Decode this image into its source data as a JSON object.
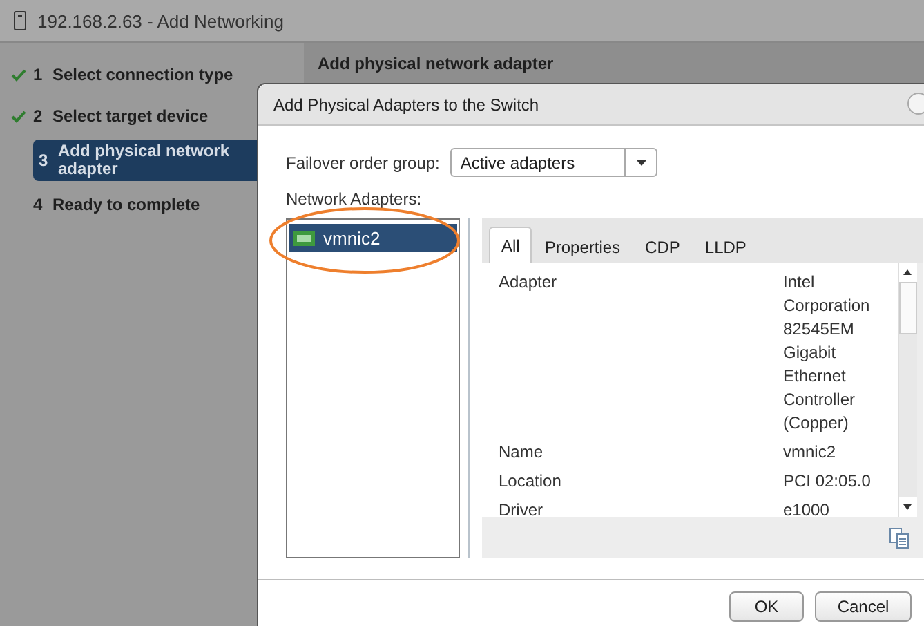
{
  "window": {
    "title": "192.168.2.63 - Add Networking"
  },
  "steps": [
    {
      "number": "1",
      "label": "Select connection type",
      "done": true,
      "selected": false
    },
    {
      "number": "2",
      "label": "Select target device",
      "done": true,
      "selected": false
    },
    {
      "number": "3",
      "label": "Add physical network adapter",
      "done": false,
      "selected": true
    },
    {
      "number": "4",
      "label": "Ready to complete",
      "done": false,
      "selected": false
    }
  ],
  "content": {
    "heading": "Add physical network adapter"
  },
  "dialog": {
    "title": "Add Physical Adapters to the Switch",
    "failover": {
      "label": "Failover order group:",
      "value": "Active adapters"
    },
    "adapters_label": "Network Adapters:",
    "adapters": [
      {
        "name": "vmnic2",
        "selected": true
      }
    ],
    "tabs": [
      {
        "label": "All",
        "selected": true
      },
      {
        "label": "Properties",
        "selected": false
      },
      {
        "label": "CDP",
        "selected": false
      },
      {
        "label": "LLDP",
        "selected": false
      }
    ],
    "properties": [
      {
        "name": "Adapter",
        "value": "Intel Corporation 82545EM Gigabit Ethernet Controller (Copper)"
      },
      {
        "name": "Name",
        "value": "vmnic2"
      },
      {
        "name": "Location",
        "value": "PCI 02:05.0"
      },
      {
        "name": "Driver",
        "value": "e1000"
      }
    ],
    "buttons": [
      {
        "label": "OK"
      },
      {
        "label": "Cancel"
      }
    ]
  }
}
